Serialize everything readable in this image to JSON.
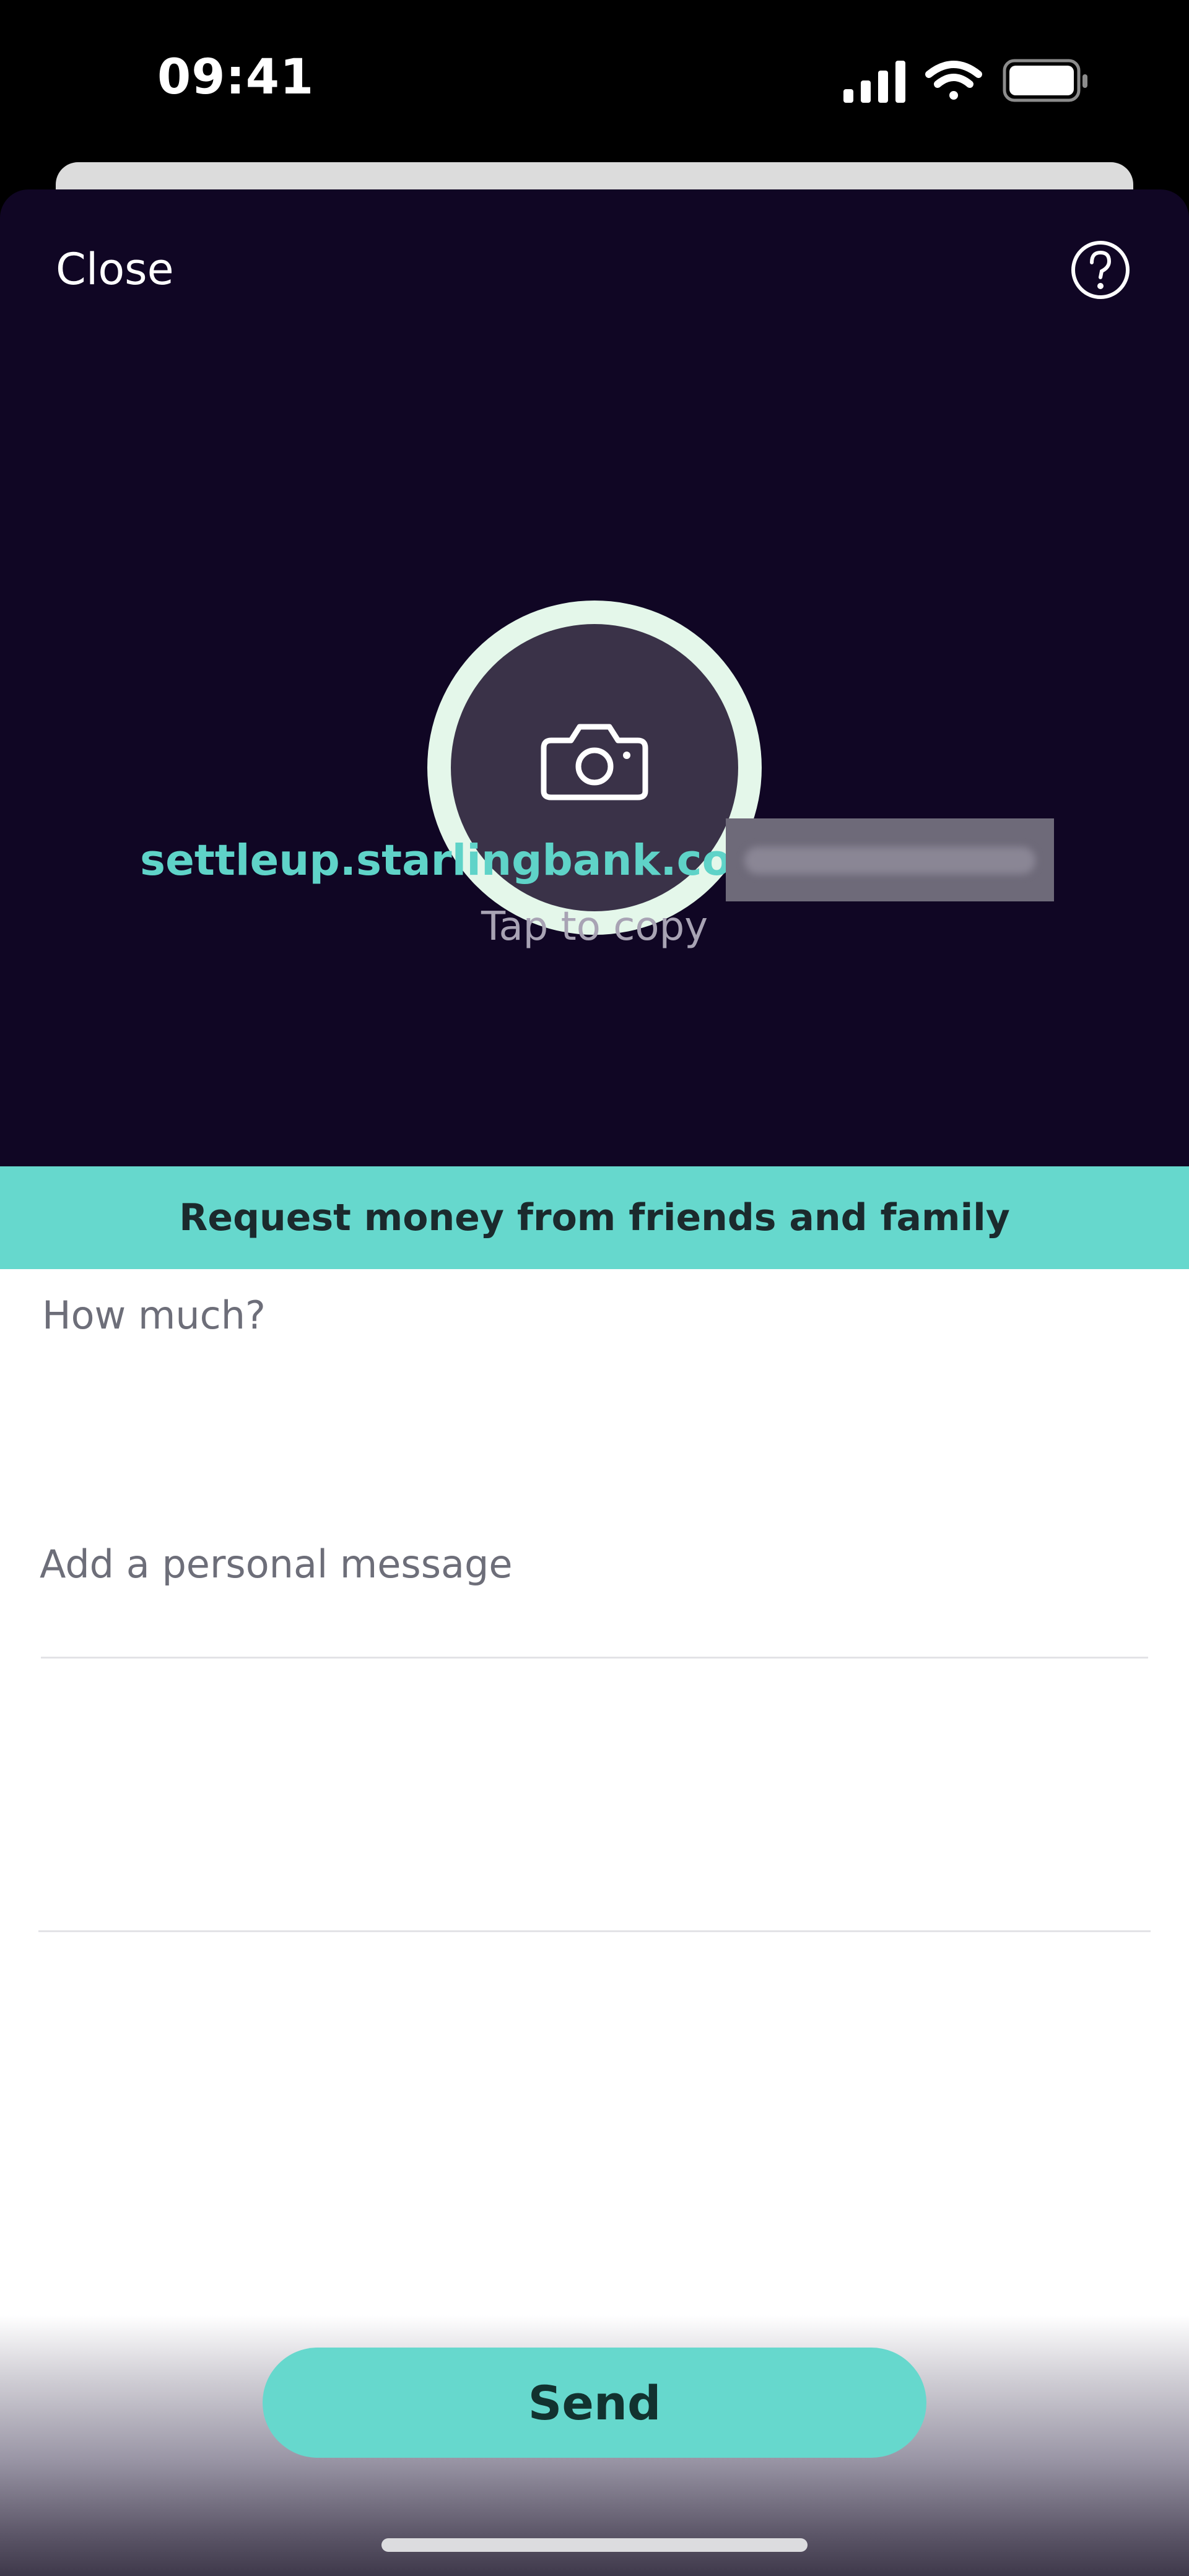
{
  "status_bar": {
    "time": "09:41",
    "icons": [
      "signal-icon",
      "wifi-icon",
      "battery-icon"
    ]
  },
  "header": {
    "close_label": "Close",
    "help_icon": "help-icon"
  },
  "avatar": {
    "icon": "camera-icon"
  },
  "link": {
    "url_prefix": "settleup.starlingbank.com/",
    "hint": "Tap to copy"
  },
  "banner": {
    "text": "Request money from friends and family"
  },
  "form": {
    "amount_placeholder": "How much?",
    "message_placeholder": "Add a personal message"
  },
  "actions": {
    "send_label": "Send"
  },
  "colors": {
    "accent": "#66d8cd",
    "sheet_background": "#100624",
    "link": "#5fd3c8"
  }
}
